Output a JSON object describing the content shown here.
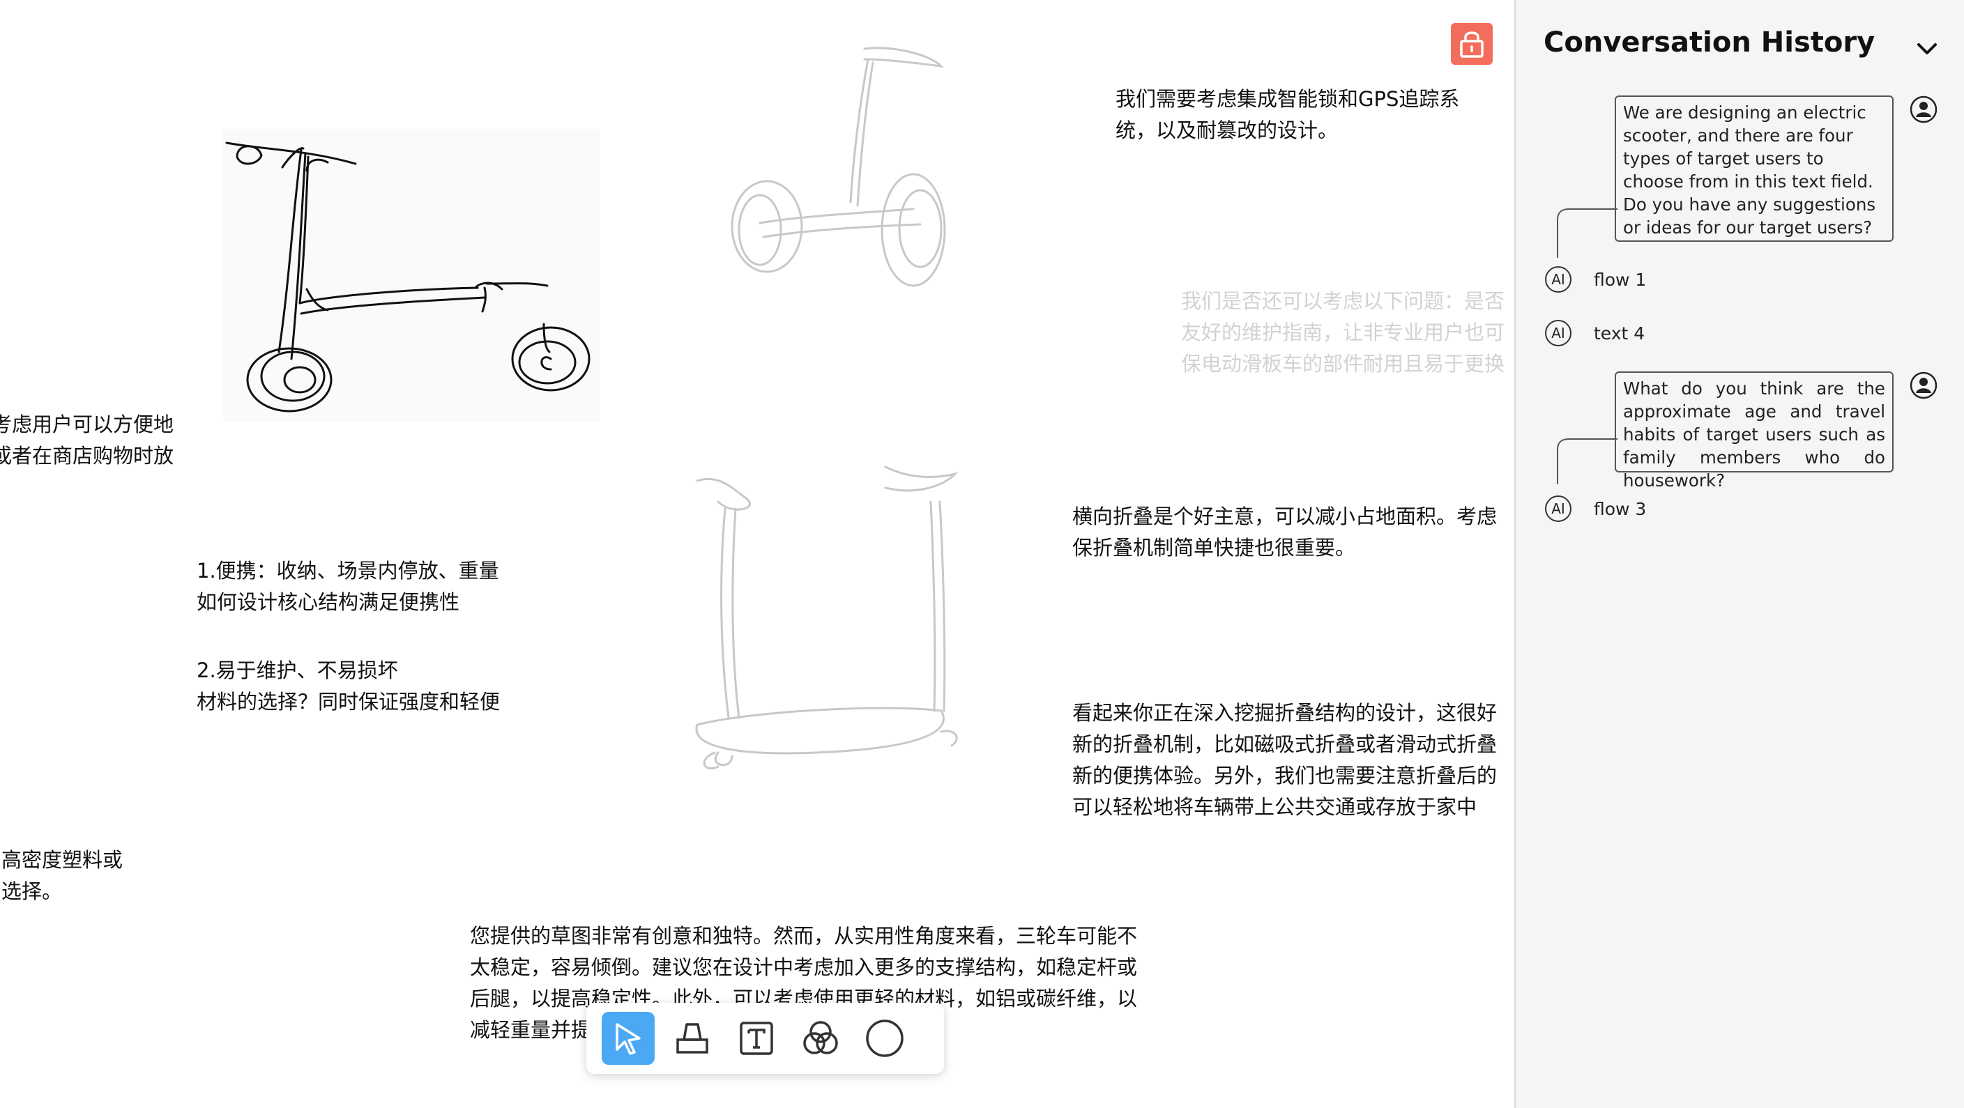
{
  "canvas": {
    "notes": {
      "smart_lock": "我们需要考虑集成智能锁和GPS追踪系\n统，以及耐篡改的设计。",
      "maintenance": "我们是否还可以考虑以下问题：是否\n友好的维护指南，让非专业用户也可\n保电动滑板车的部件耐用且易于更换",
      "left_cut": "考虑用户可以方便地\n或者在商店购物时放",
      "portable": "1.便携：收纳、场景内停放、重量\n如何设计核心结构满足便携性",
      "maintain": "2.易于维护、不易损坏\n材料的选择？同时保证强度和轻便",
      "folding": "横向折叠是个好主意，可以减小占地面积。考虑\n保折叠机制简单快捷也很重要。",
      "deep_fold": "看起来你正在深入挖掘折叠结构的设计，这很好\n新的折叠机制，比如磁吸式折叠或者滑动式折叠\n新的便携体验。另外，我们也需要注意折叠后的\n可以轻松地将车辆带上公共交通或存放于家中",
      "plastic": "高密度塑料或\n选择。",
      "feedback": "您提供的草图非常有创意和独特。然而，从实用性角度来看，三轮车可能不\n太稳定，容易倾倒。建议您在设计中考虑加入更多的支撑结构，如稳定杆或\n后腿，以提高稳定性。此外，可以考虑使用更轻的材料，如铝或碳纤维，以\n减轻重量并提"
    }
  },
  "lock_icon": "lock-icon",
  "toolbar": {
    "tools": [
      "select-cursor-icon",
      "eraser-icon",
      "text-tool-icon",
      "shapes-icon",
      "circle-icon"
    ],
    "active": "select-cursor-icon",
    "accent": "#4aa8f5"
  },
  "panel": {
    "title": "Conversation History",
    "messages": [
      {
        "role": "user",
        "text": "We are designing an electric scooter, and there are four types of target users to choose from in this text field. Do you have any suggestions or ideas for our target users?"
      },
      {
        "role": "ai",
        "badge": "AI",
        "label": "flow 1"
      },
      {
        "role": "ai",
        "badge": "AI",
        "label": "text 4"
      },
      {
        "role": "user",
        "text": "What do you think are the approximate age and travel habits of target users such as family members who do housework?"
      },
      {
        "role": "ai",
        "badge": "AI",
        "label": "flow 3"
      }
    ]
  },
  "colors": {
    "lock": "#f26d5b",
    "faded_text": "#d2d2d2",
    "panel_bg": "#f5f5f5"
  }
}
